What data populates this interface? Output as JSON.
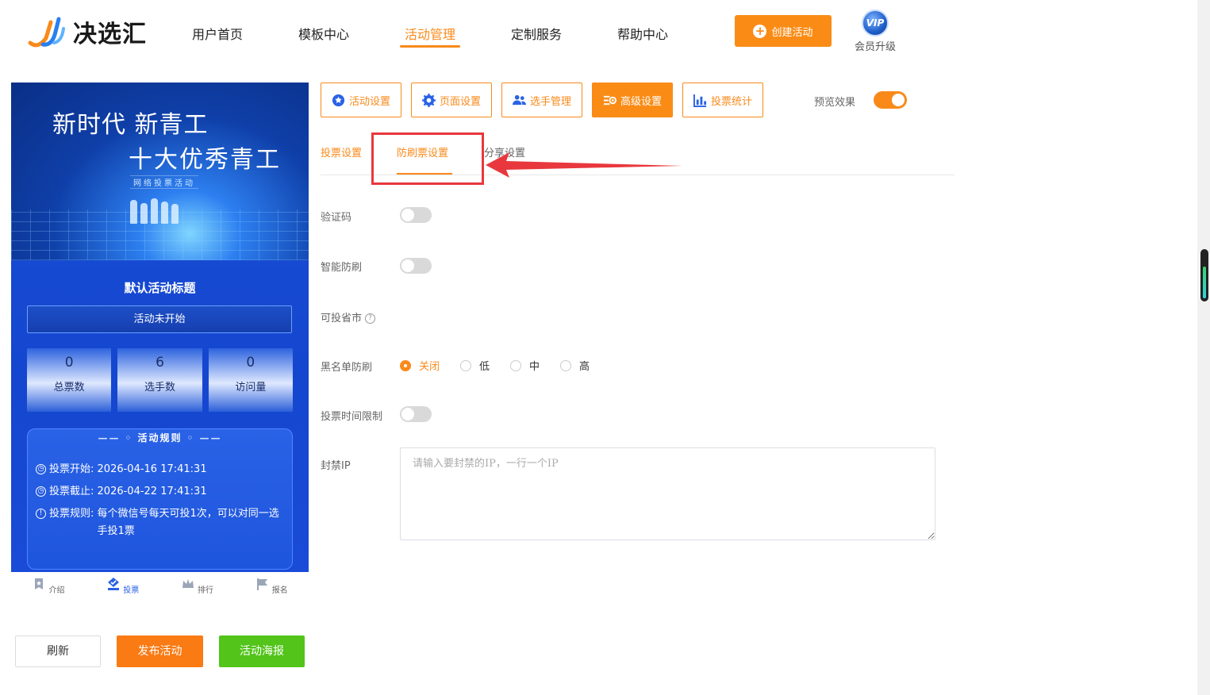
{
  "brand": {
    "name": "决选汇"
  },
  "nav": {
    "items": [
      "用户首页",
      "模板中心",
      "活动管理",
      "定制服务",
      "帮助中心"
    ],
    "active_index": 2,
    "create_label": "创建活动",
    "vip_badge": "VIP",
    "vip_label": "会员升级"
  },
  "preview": {
    "banner_line1": "新时代 新青工",
    "banner_line2": "十大优秀青工",
    "banner_sub": "网络投票活动",
    "title": "默认活动标题",
    "status": "活动未开始",
    "stats": [
      {
        "value": "0",
        "label": "总票数"
      },
      {
        "value": "6",
        "label": "选手数"
      },
      {
        "value": "0",
        "label": "访问量"
      }
    ],
    "rules_title": "活动规则",
    "rules": [
      {
        "key": "投票开始:",
        "value": "2026-04-16 17:41:31",
        "icon": "clock-icon"
      },
      {
        "key": "投票截止:",
        "value": "2026-04-22 17:41:31",
        "icon": "clock-icon"
      },
      {
        "key": "投票规则:",
        "value": "每个微信号每天可投1次，可以对同一选手投1票",
        "icon": "info-icon"
      }
    ],
    "tabbar": [
      "介绍",
      "投票",
      "排行",
      "报名"
    ],
    "tabbar_active": 1
  },
  "actions": {
    "refresh": "刷新",
    "publish": "发布活动",
    "poster": "活动海报"
  },
  "toolbar": {
    "buttons": [
      "活动设置",
      "页面设置",
      "选手管理",
      "高级设置",
      "投票统计"
    ],
    "active_index": 3,
    "preview_label": "预览效果",
    "preview_on": true
  },
  "subtabs": {
    "items": [
      "投票设置",
      "防刷票设置",
      "分享设置"
    ],
    "active_index": 1
  },
  "form": {
    "captcha_label": "验证码",
    "smart_label": "智能防刷",
    "region_label": "可投省市",
    "blacklist_label": "黑名单防刷",
    "blacklist_options": [
      "关闭",
      "低",
      "中",
      "高"
    ],
    "blacklist_selected": "关闭",
    "time_limit_label": "投票时间限制",
    "ban_ip_label": "封禁IP",
    "ban_ip_placeholder": "请输入要封禁的IP，一行一个IP"
  },
  "colors": {
    "accent": "#fa8c16",
    "green": "#52c41a",
    "highlight": "#e8383d",
    "preview_blue": "#1b4fd6"
  }
}
